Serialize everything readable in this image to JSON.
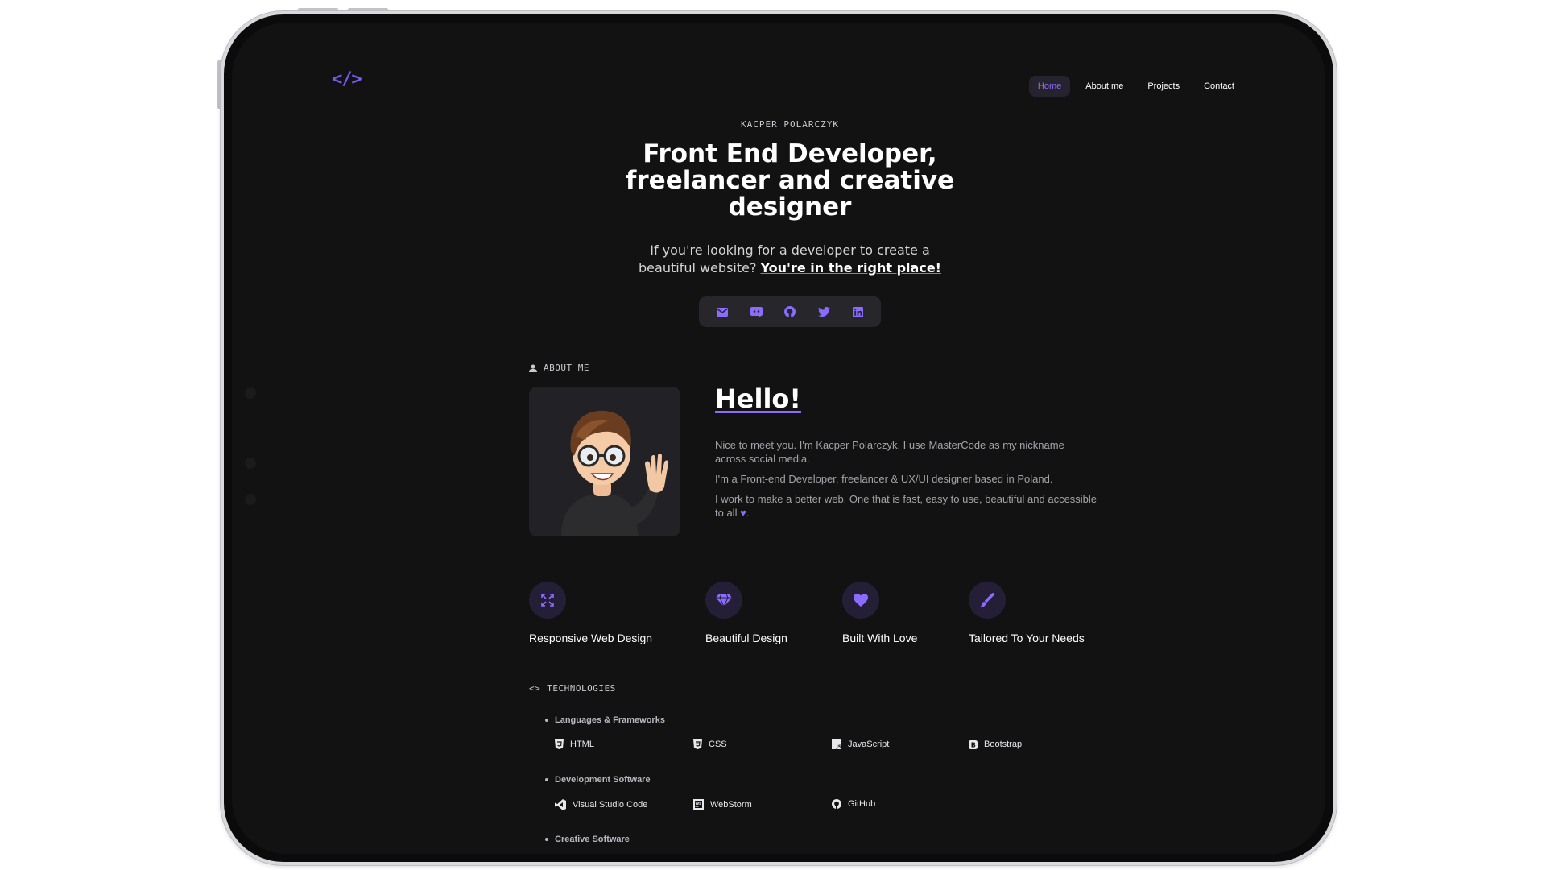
{
  "nav": {
    "logo": "</>",
    "links": [
      {
        "label": "Home",
        "active": true
      },
      {
        "label": "About me",
        "active": false
      },
      {
        "label": "Projects",
        "active": false
      },
      {
        "label": "Contact",
        "active": false
      }
    ]
  },
  "hero": {
    "eyebrow": "KACPER POLARCZYK",
    "headline": "Front End Developer, freelancer and creative designer",
    "subline_text": "If you're looking for a developer to create a beautiful website? ",
    "subline_link": "You're in the right place!",
    "socials": [
      "mail-icon",
      "discord-icon",
      "github-icon",
      "twitter-icon",
      "linkedin-icon"
    ]
  },
  "about": {
    "section_label": "ABOUT ME",
    "greeting": "Hello!",
    "paragraphs": [
      "Nice to meet you. I'm Kacper Polarczyk. I use MasterCode as my nickname across social media.",
      "I'm a Front-end Developer, freelancer & UX/UI designer based in Poland.",
      "I work to make a better web. One that is fast, easy to use, beautiful and accessible to all"
    ],
    "paragraph_end": "."
  },
  "features": [
    {
      "label": "Responsive Web Design",
      "icon": "expand-icon"
    },
    {
      "label": "Beautiful Design",
      "icon": "diamond-icon"
    },
    {
      "label": "Built With Love",
      "icon": "heart-icon"
    },
    {
      "label": "Tailored To Your Needs",
      "icon": "brush-icon"
    }
  ],
  "technologies": {
    "section_label": "TECHNOLOGIES",
    "groups": [
      {
        "title": "Languages & Frameworks",
        "items": [
          "HTML",
          "CSS",
          "JavaScript",
          "Bootstrap"
        ]
      },
      {
        "title": "Development Software",
        "items": [
          "Visual Studio Code",
          "WebStorm",
          "GitHub"
        ]
      },
      {
        "title": "Creative Software",
        "items": []
      }
    ]
  },
  "colors": {
    "accent": "#8b6cff",
    "background": "#121213",
    "card": "#26262b"
  }
}
